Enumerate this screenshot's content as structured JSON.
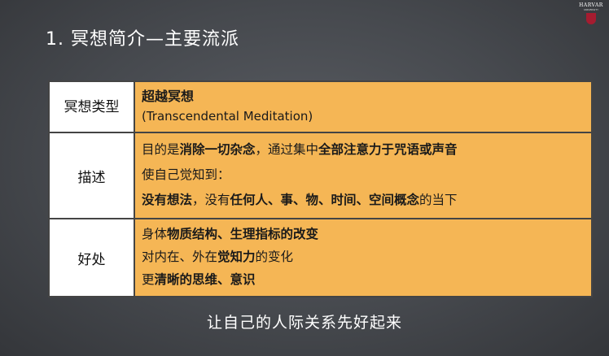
{
  "slide": {
    "title": "1. 冥想简介—主要流派",
    "logo": {
      "word": "HARVAR",
      "sub": "UNIVERSITY"
    },
    "subtitle": "让自己的人际关系先好起来"
  },
  "table": {
    "rows": [
      {
        "label": "冥想类型",
        "lines": [
          [
            {
              "t": "超越冥想",
              "b": true
            }
          ],
          [
            {
              "t": "(Transcendental Meditation)",
              "b": false
            }
          ]
        ]
      },
      {
        "label": "描述",
        "lines": [
          [
            {
              "t": "目的是",
              "b": false
            },
            {
              "t": "消除一切杂念",
              "b": true
            },
            {
              "t": "，通过集中",
              "b": false
            },
            {
              "t": "全部注意力于咒语或声音",
              "b": true
            }
          ],
          [
            {
              "t": "使自己觉知到：",
              "b": false
            }
          ],
          [
            {
              "t": "没有想法",
              "b": true
            },
            {
              "t": "，没有",
              "b": false
            },
            {
              "t": "任何人、事、物、时间、空间概念",
              "b": true
            },
            {
              "t": "的当下",
              "b": false
            }
          ]
        ]
      },
      {
        "label": "好处",
        "lines": [
          [
            {
              "t": "身体",
              "b": false
            },
            {
              "t": "物质结构、生理指标的改变",
              "b": true
            }
          ],
          [
            {
              "t": "对内在、外在",
              "b": false
            },
            {
              "t": "觉知力",
              "b": true
            },
            {
              "t": "的变化",
              "b": false
            }
          ],
          [
            {
              "t": "更",
              "b": false
            },
            {
              "t": "清晰的思维、意识",
              "b": true
            }
          ]
        ]
      }
    ]
  }
}
